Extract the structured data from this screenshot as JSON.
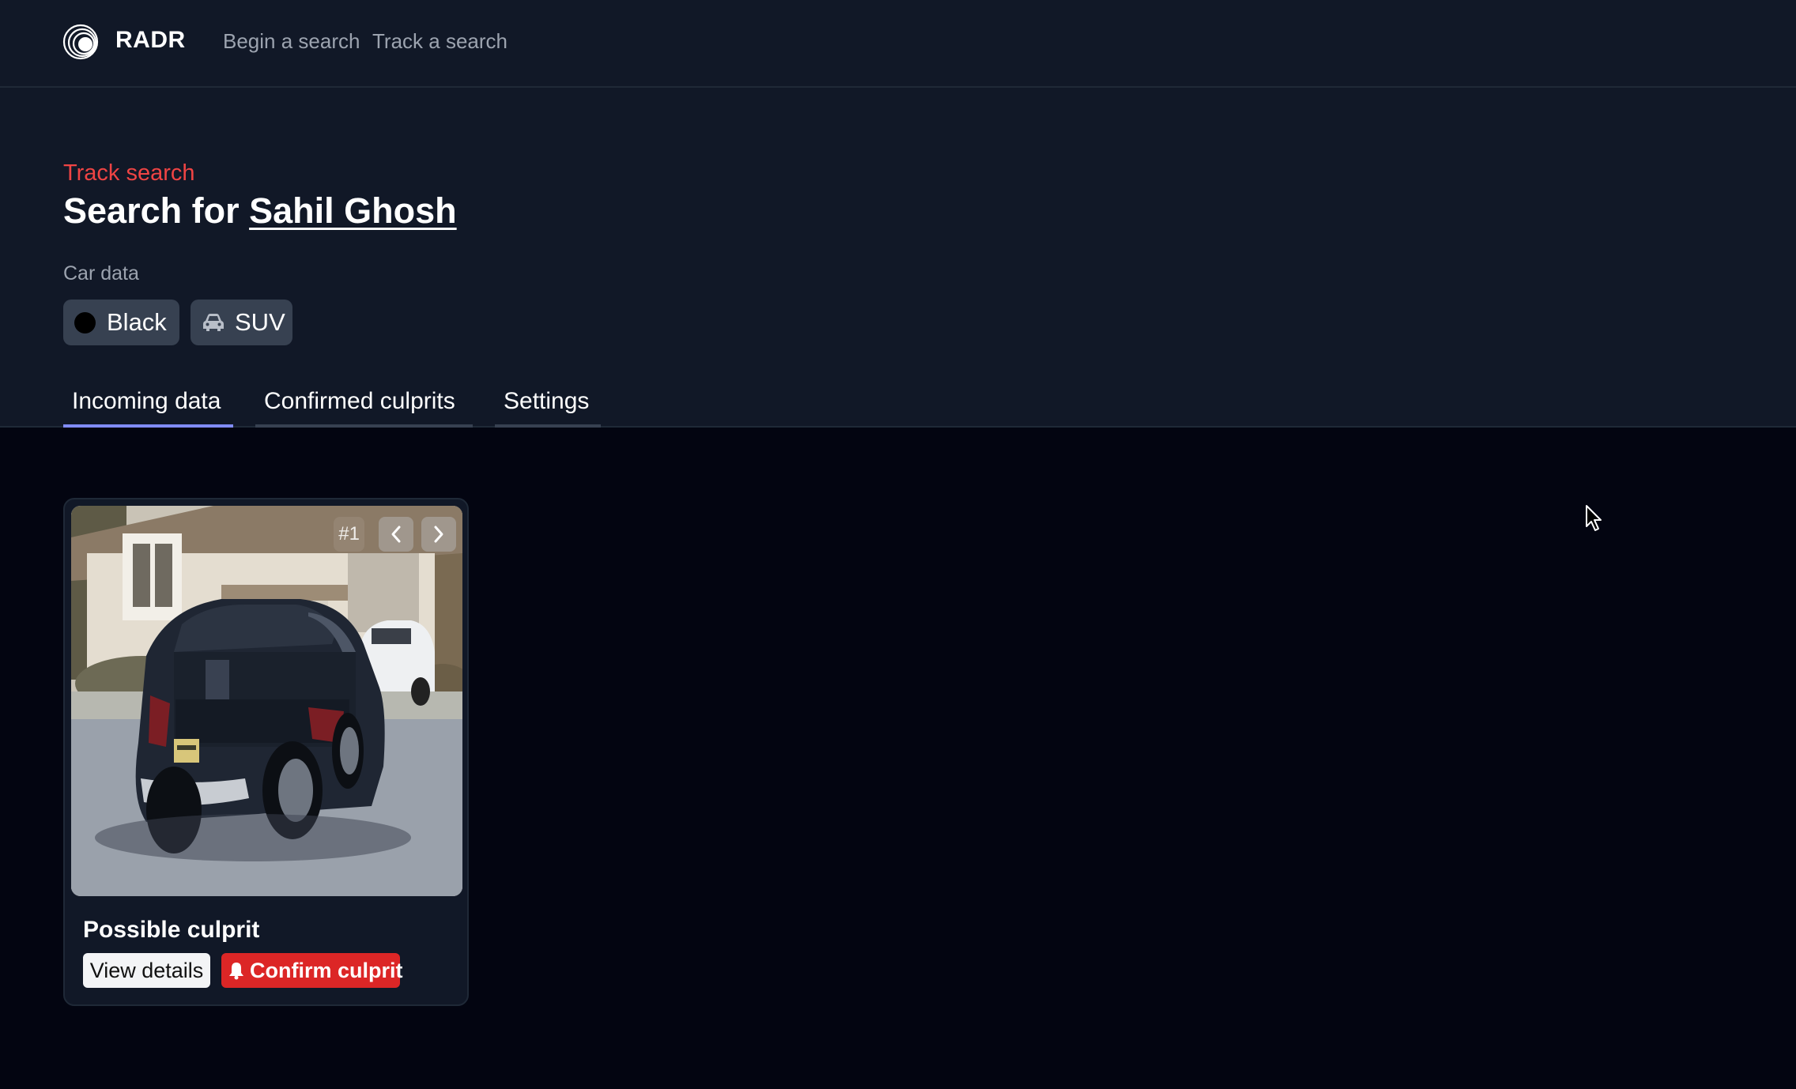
{
  "nav": {
    "brand": "RADR",
    "logo_icon": "radar-logo-icon",
    "links": [
      "Begin a search",
      "Track a search"
    ]
  },
  "header": {
    "eyebrow": "Track search",
    "title_prefix": "Search for",
    "person_name": "Sahil Ghosh",
    "car_data_label": "Car data",
    "chips": {
      "color": "Black",
      "type": "SUV"
    }
  },
  "tabs": [
    {
      "label": "Incoming data",
      "active": true
    },
    {
      "label": "Confirmed culprits",
      "active": false
    },
    {
      "label": "Settings",
      "active": false
    }
  ],
  "cards": [
    {
      "counter": "#1",
      "title": "Possible culprit",
      "view_label": "View details",
      "confirm_label": "Confirm culprit"
    }
  ],
  "colors": {
    "accent_red": "#ef4444",
    "confirm_red": "#dc2626",
    "active_tab": "#818cf8",
    "panel": "#111827",
    "background": "#030511"
  }
}
